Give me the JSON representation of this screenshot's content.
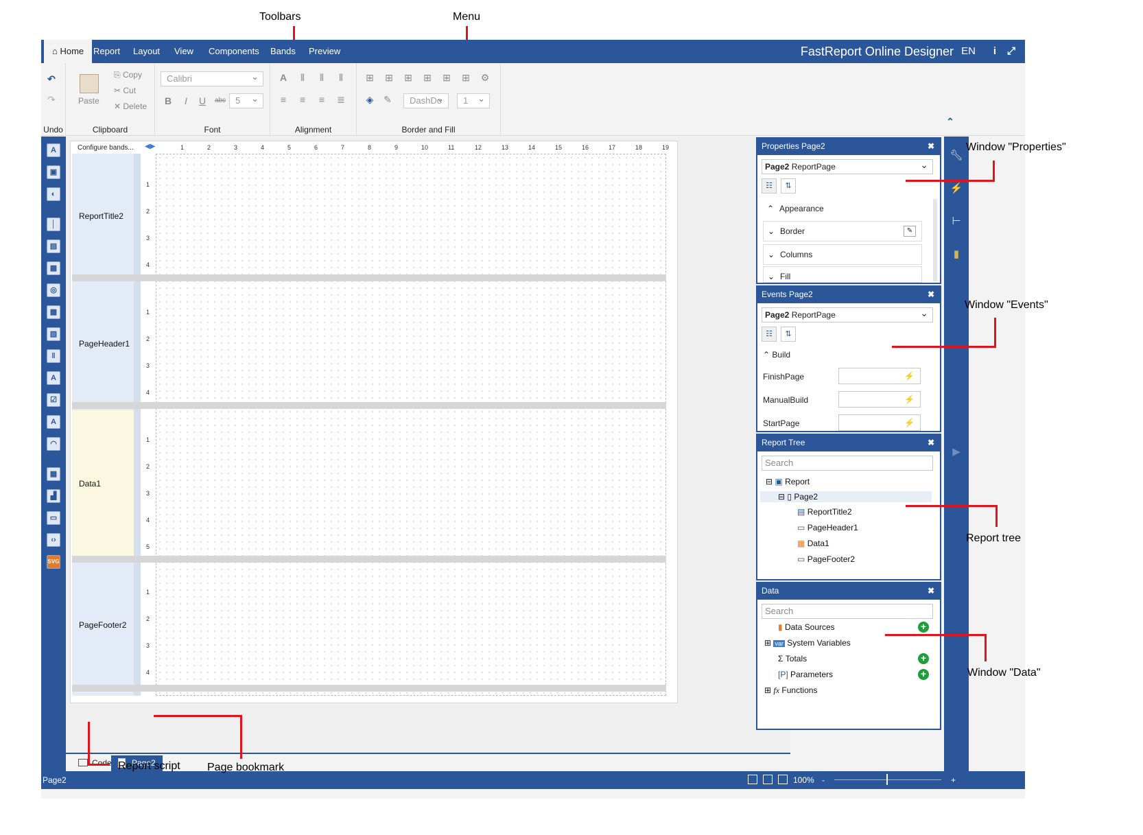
{
  "menu": {
    "tabs": [
      "Home",
      "Report",
      "Layout",
      "View",
      "Components",
      "Bands",
      "Preview"
    ],
    "active": "Home",
    "brand": "FastReport Online Designer",
    "lang": "EN"
  },
  "ribbon": {
    "undo_caption": "Undo",
    "clipboard": {
      "caption": "Clipboard",
      "paste": "Paste",
      "copy": "Copy",
      "cut": "Cut",
      "delete": "Delete"
    },
    "font": {
      "caption": "Font",
      "family": "Calibri",
      "size": "5"
    },
    "alignment": {
      "caption": "Alignment"
    },
    "border_fill": {
      "caption": "Border and Fill",
      "dash": "DashDo",
      "width": "1"
    }
  },
  "canvas": {
    "configure_bands": "Configure bands...",
    "ruler": [
      "1",
      "2",
      "3",
      "4",
      "5",
      "6",
      "7",
      "8",
      "9",
      "10",
      "11",
      "12",
      "13",
      "14",
      "15",
      "16",
      "17",
      "18",
      "19"
    ],
    "bands": [
      {
        "name": "ReportTitle2",
        "ticks": [
          "1",
          "2",
          "3",
          "4"
        ]
      },
      {
        "name": "PageHeader1",
        "ticks": [
          "1",
          "2",
          "3",
          "4"
        ]
      },
      {
        "name": "Data1",
        "ticks": [
          "1",
          "2",
          "3",
          "4",
          "5"
        ]
      },
      {
        "name": "PageFooter2",
        "ticks": [
          "1",
          "2",
          "3",
          "4"
        ]
      }
    ]
  },
  "page_tabs": {
    "code": "Code",
    "page": "Page2"
  },
  "status": {
    "page": "Page2",
    "zoom": "100%",
    "minus": "-",
    "plus": "+"
  },
  "properties": {
    "title": "Properties Page2",
    "object_name": "Page2",
    "object_type": "ReportPage",
    "rows": [
      "Appearance",
      "Border",
      "Columns",
      "Fill"
    ]
  },
  "events": {
    "title": "Events Page2",
    "object_name": "Page2",
    "object_type": "ReportPage",
    "group": "Build",
    "rows": [
      "FinishPage",
      "ManualBuild",
      "StartPage"
    ]
  },
  "report_tree": {
    "title": "Report Tree",
    "search": "Search",
    "items": [
      "Report",
      "Page2",
      "ReportTitle2",
      "PageHeader1",
      "Data1",
      "PageFooter2"
    ]
  },
  "data_window": {
    "title": "Data",
    "search": "Search",
    "items": [
      "Data Sources",
      "System Variables",
      "Totals",
      "Parameters",
      "Functions"
    ]
  },
  "annotations": {
    "toolbars": "Toolbars",
    "menu": "Menu",
    "properties": "Window \"Properties\"",
    "events": "Window \"Events\"",
    "report_tree": "Report tree",
    "data": "Window \"Data\"",
    "report_script": "Report script",
    "page_bookmark": "Page bookmark"
  },
  "colors": {
    "accent": "#2b579a",
    "annotation_line": "#e1141e",
    "add": "#1e9d3a"
  }
}
